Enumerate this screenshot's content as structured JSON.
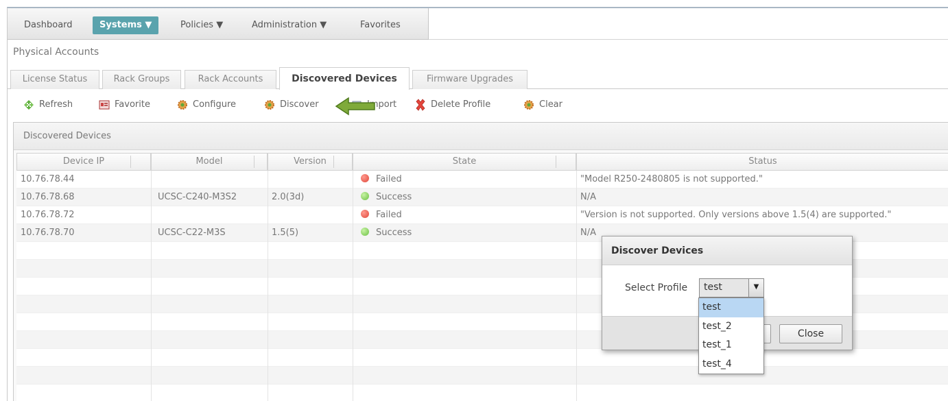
{
  "topnav": {
    "items": [
      {
        "label": "Dashboard",
        "active": false
      },
      {
        "label": "Systems ▼",
        "active": true
      },
      {
        "label": "Policies ▼",
        "active": false
      },
      {
        "label": "Administration ▼",
        "active": false
      },
      {
        "label": "Favorites",
        "active": false
      }
    ],
    "active_color": "#5aa3ad"
  },
  "breadcrumb": "Physical Accounts",
  "tabs": [
    {
      "label": "License Status",
      "active": false
    },
    {
      "label": "Rack Groups",
      "active": false
    },
    {
      "label": "Rack Accounts",
      "active": false
    },
    {
      "label": "Discovered Devices",
      "active": true
    },
    {
      "label": "Firmware Upgrades",
      "active": false
    }
  ],
  "toolbar": {
    "refresh": "Refresh",
    "favorite": "Favorite",
    "configure": "Configure",
    "discover": "Discover",
    "import": "Import",
    "delete_profile": "Delete Profile",
    "clear": "Clear"
  },
  "panel": {
    "title": "Discovered Devices"
  },
  "table": {
    "columns": [
      "Device IP",
      "Model",
      "Version",
      "State",
      "Status"
    ],
    "rows": [
      {
        "ip": "10.76.78.44",
        "model": "",
        "version": "",
        "state": "Failed",
        "status": "\"Model R250-2480805 is not supported.\""
      },
      {
        "ip": "10.76.78.68",
        "model": "UCSC-C240-M3S2",
        "version": "2.0(3d)",
        "state": "Success",
        "status": "N/A"
      },
      {
        "ip": "10.76.78.72",
        "model": "",
        "version": "",
        "state": "Failed",
        "status": "\"Version  is not supported. Only versions above 1.5(4) are supported.\""
      },
      {
        "ip": "10.76.78.70",
        "model": "UCSC-C22-M3S",
        "version": "1.5(5)",
        "state": "Success",
        "status": "N/A"
      }
    ],
    "state_colors": {
      "Failed": "#e0473a",
      "Success": "#6bc043"
    }
  },
  "dialog": {
    "title": "Discover Devices",
    "select_label": "Select Profile",
    "select_value": "test",
    "options": [
      "test",
      "test_2",
      "test_1",
      "test_4"
    ],
    "close_label": "Close"
  }
}
